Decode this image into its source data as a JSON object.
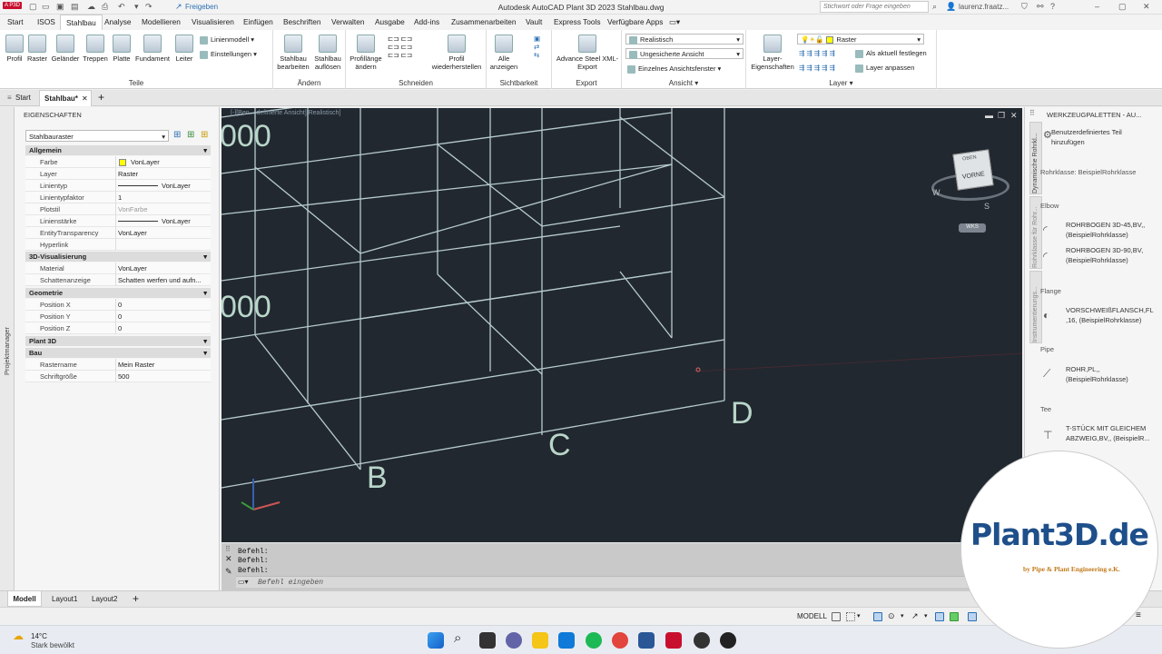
{
  "title_bar": {
    "app_badge": "A P3D",
    "share_label": "Freigeben",
    "title": "Autodesk AutoCAD Plant 3D 2023   Stahlbau.dwg",
    "search_placeholder": "Stichwort oder Frage eingeben",
    "user": "laurenz.fraatz..."
  },
  "menu_tabs": [
    "Start",
    "ISOS",
    "Stahlbau",
    "Analyse",
    "Modellieren",
    "Visualisieren",
    "Einfügen",
    "Beschriften",
    "Verwalten",
    "Ausgabe",
    "Add-ins",
    "Zusammenarbeiten",
    "Vault",
    "Express Tools",
    "Verfügbare Apps"
  ],
  "ribbon": {
    "teile": {
      "label": "Teile",
      "buttons": [
        "Profil",
        "Raster",
        "Geländer",
        "Treppen",
        "Platte",
        "Fundament",
        "Leiter"
      ],
      "linienmodell": "Linienmodell",
      "einstellungen": "Einstellungen"
    },
    "aendern": {
      "label": "Ändern",
      "buttons": [
        "Stahlbau bearbeiten",
        "Stahlbau auflösen"
      ]
    },
    "schneiden": {
      "label": "Schneiden",
      "buttons": [
        "Profillänge ändern",
        "Profil wiederherstellen"
      ]
    },
    "sichtbarkeit": {
      "label": "Sichtbarkeit",
      "buttons": [
        "Alle anzeigen"
      ]
    },
    "export": {
      "label": "Export",
      "buttons": [
        "Advance Steel XML-Export"
      ]
    },
    "ansicht": {
      "label": "Ansicht",
      "visual_style": "Realistisch",
      "view": "Ungesicherte Ansicht",
      "viewport": "Einzelnes Ansichtsfenster"
    },
    "layer": {
      "label": "Layer",
      "props_button": "Layer-Eigenschaften",
      "current_layer": "Raster",
      "set_current": "Als aktuell festlegen",
      "match": "Layer anpassen"
    }
  },
  "doc_tabs": [
    "Start",
    "Stahlbau*"
  ],
  "left_strip_label": "Projektmanager",
  "properties": {
    "title": "EIGENSCHAFTEN",
    "selected": "Stahlbauraster",
    "sections": [
      {
        "name": "Allgemein",
        "rows": [
          [
            "Farbe",
            "VonLayer"
          ],
          [
            "Layer",
            "Raster"
          ],
          [
            "Linientyp",
            "VonLayer"
          ],
          [
            "Linientypfaktor",
            "1"
          ],
          [
            "Plotstil",
            "VonFarbe"
          ],
          [
            "Linienstärke",
            "VonLayer"
          ],
          [
            "EntityTransparency",
            "VonLayer"
          ],
          [
            "Hyperlink",
            ""
          ]
        ]
      },
      {
        "name": "3D-Visualisierung",
        "rows": [
          [
            "Material",
            "VonLayer"
          ],
          [
            "Schattenanzeige",
            "Schatten werfen und aufn..."
          ]
        ]
      },
      {
        "name": "Geometrie",
        "rows": [
          [
            "Position X",
            "0"
          ],
          [
            "Position Y",
            "0"
          ],
          [
            "Position Z",
            "0"
          ]
        ]
      },
      {
        "name": "Plant 3D",
        "rows": []
      },
      {
        "name": "Bau",
        "rows": [
          [
            "Rastername",
            "Mein Raster"
          ],
          [
            "Schriftgröße",
            "500"
          ]
        ]
      }
    ]
  },
  "viewport": {
    "header": "[-][Ben... definierte Ansicht][Realistisch]",
    "grid_labels": [
      "B",
      "C",
      "D"
    ],
    "dimension_texts": [
      "000",
      "000"
    ],
    "viewcube_face": "VORNE",
    "viewcube_top": "OBEN",
    "compass": [
      "W",
      "S"
    ],
    "ucs_label": "WKS"
  },
  "command": {
    "history": [
      "Befehl:",
      "Befehl:",
      "Befehl:"
    ],
    "placeholder": "Befehl eingeben"
  },
  "palette": {
    "title": "WERKZEUGPALETTEN - AU...",
    "vertical_tabs": [
      "Dynamische Rohrkl...",
      "Rohrklasse für Rohr...",
      "Instrumentierungs..."
    ],
    "custom_part": "Benutzerdefiniertes Teil hinzufügen",
    "pipe_class": "Rohrklasse: BeispielRohrklasse",
    "groups": [
      {
        "header": "Elbow",
        "items": [
          "ROHRBOGEN 3D-45,BV,, (BeispielRohrklasse)",
          "ROHRBOGEN 3D-90,BV, (BeispielRohrklasse)"
        ]
      },
      {
        "header": "Flange",
        "items": [
          "VORSCHWEIßFLANSCH,FL ,16, (BeispielRohrklasse)"
        ]
      },
      {
        "header": "Pipe",
        "items": [
          "ROHR,PL,, (BeispielRohrklasse)"
        ]
      },
      {
        "header": "Tee",
        "items": [
          "T-STÜCK MIT GLEICHEM ABZWEIG,BV,, (BeispielR..."
        ]
      }
    ]
  },
  "layout_tabs": [
    "Modell",
    "Layout1",
    "Layout2"
  ],
  "status": {
    "model": "MODELL"
  },
  "weather": {
    "temp": "14°C",
    "desc": "Stark bewölkt"
  },
  "logo": {
    "main": "Plant3D.de",
    "sub": "by Pipe & Plant Engineering e.K."
  },
  "colors": {
    "viewport_bg": "#212830",
    "grid_line": "#c8dde0",
    "label": "#b9d6c9",
    "logo_blue": "#1e4f8a"
  }
}
